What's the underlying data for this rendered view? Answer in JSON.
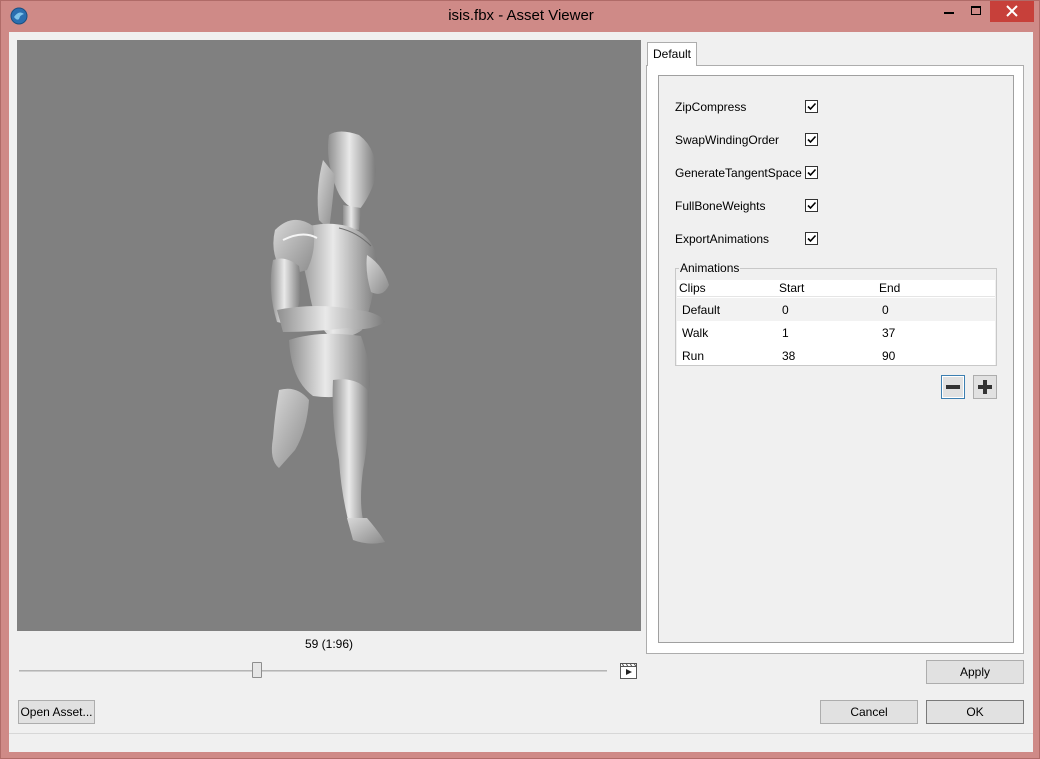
{
  "window": {
    "title": "isis.fbx - Asset Viewer",
    "controls": {
      "minimize": "minimize",
      "maximize": "maximize",
      "close": "close"
    }
  },
  "viewport": {
    "frame_label": "59 (1:96)",
    "slider_position": 0.41
  },
  "tabs": [
    {
      "label": "Default",
      "active": true
    }
  ],
  "options": [
    {
      "label": "ZipCompress",
      "checked": true
    },
    {
      "label": "SwapWindingOrder",
      "checked": true
    },
    {
      "label": "GenerateTangentSpace",
      "checked": true
    },
    {
      "label": "FullBoneWeights",
      "checked": true
    },
    {
      "label": "ExportAnimations",
      "checked": true
    }
  ],
  "animations": {
    "title": "Animations",
    "columns": [
      "Clips",
      "Start",
      "End"
    ],
    "rows": [
      {
        "clip": "Default",
        "start": "0",
        "end": "0"
      },
      {
        "clip": "Walk",
        "start": "1",
        "end": "37"
      },
      {
        "clip": "Run",
        "start": "38",
        "end": "90"
      }
    ],
    "remove_icon": "minus-icon",
    "add_icon": "plus-icon"
  },
  "buttons": {
    "apply": "Apply",
    "open_asset": "Open Asset...",
    "cancel": "Cancel",
    "ok": "OK"
  },
  "colors": {
    "window_frame": "#cf8a87",
    "close_button": "#c7403a",
    "viewport_bg": "#808080"
  }
}
